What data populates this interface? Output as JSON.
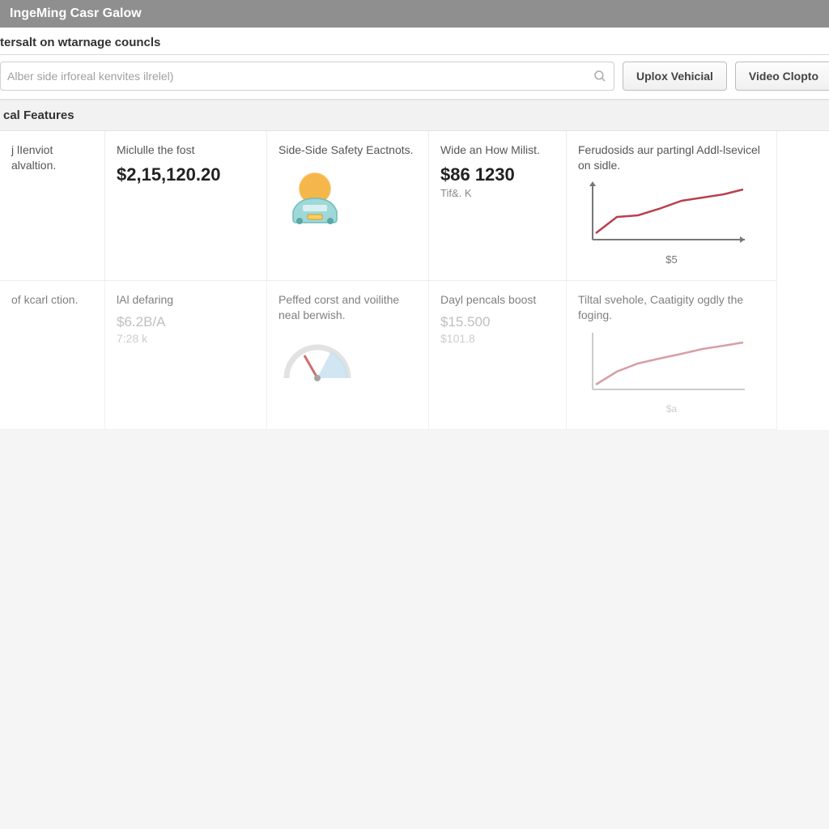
{
  "header": {
    "app_title": "IngeMing Casr Galow",
    "subtitle": "tersalt on wtarnage councls"
  },
  "search": {
    "placeholder": "Alber side irforeal kenvites ilrelel)"
  },
  "buttons": {
    "upload": "Uplox Vehicial",
    "video": "Video Clopto"
  },
  "section_title": "cal Features",
  "cards_row1": [
    {
      "title": "j lIenviot alvaltion."
    },
    {
      "title": "Miclulle the fost",
      "big": "$2,15,120.20"
    },
    {
      "title": "Side-Side Safety Eactnots."
    },
    {
      "title": "Wide an How Milist.",
      "big": "$86 1230",
      "sub": "Tif&. K"
    },
    {
      "title": "Ferudosids aur partingl Addl-lsevicel on sidle.",
      "spark_label": "$5"
    }
  ],
  "cards_row2": [
    {
      "title": "of kcarl ction."
    },
    {
      "title": "lAl defaring",
      "muted_big": "$6.2B/A",
      "muted_sub": "7:28 k"
    },
    {
      "title": "Peffed corst and voilithe neal berwish."
    },
    {
      "title": "Dayl pencals boost",
      "muted_big": "$15.500",
      "muted_sub": "$101.8"
    },
    {
      "title": "Tiltal svehole, Caatigity ogdly the foging.",
      "spark_label": "$a"
    }
  ],
  "chart_data": [
    {
      "type": "line",
      "title": "Ferudosids aur partingl Addl-lsevicel on sidle.",
      "x": [
        0,
        1,
        2,
        3,
        4,
        5,
        6,
        7
      ],
      "values": [
        10,
        28,
        35,
        42,
        55,
        58,
        62,
        70
      ],
      "xlabel": "$5",
      "ylabel": "",
      "ylim": [
        0,
        80
      ],
      "color": "#b8414f"
    },
    {
      "type": "line",
      "title": "Tiltal svehole, Caatigity ogdly the foging.",
      "x": [
        0,
        1,
        2,
        3,
        4,
        5,
        6,
        7
      ],
      "values": [
        8,
        22,
        34,
        40,
        48,
        54,
        58,
        64
      ],
      "xlabel": "$a",
      "ylabel": "",
      "ylim": [
        0,
        80
      ],
      "color": "#c97f88"
    }
  ]
}
